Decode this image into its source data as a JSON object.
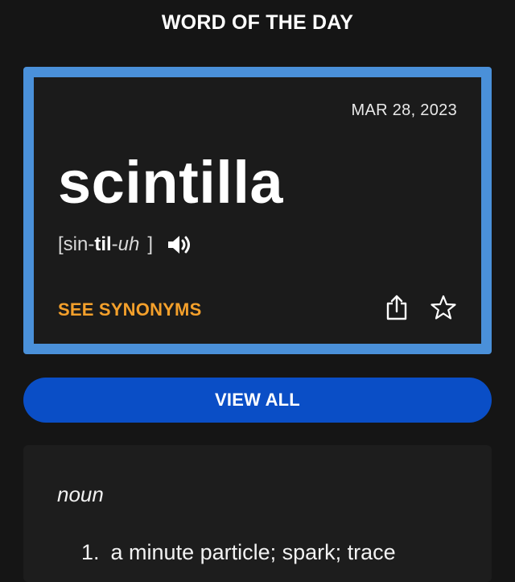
{
  "header": {
    "title": "WORD OF THE DAY"
  },
  "card": {
    "date": "MAR 28, 2023",
    "word": "scintilla",
    "pronunciation": {
      "open": "[",
      "syl1": " sin-",
      "syl2": "til",
      "syl3": "-",
      "syl4": "uh",
      "close": "]"
    },
    "synonyms_label": "SEE SYNONYMS",
    "icons": {
      "audio": "speaker-icon",
      "share": "share-icon",
      "favorite": "star-icon"
    },
    "border_color": "#4a90d9",
    "accent_color": "#f4a02b"
  },
  "view_all": {
    "label": "VIEW ALL",
    "color": "#0a4ec6"
  },
  "definition": {
    "part_of_speech": "noun",
    "items": [
      {
        "num": "1.",
        "text": "a minute particle; spark; trace"
      }
    ]
  }
}
